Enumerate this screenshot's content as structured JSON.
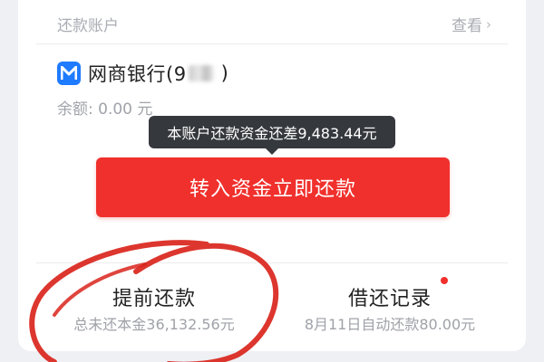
{
  "account_section": {
    "title": "还款账户",
    "view_label": "查看",
    "view_icon": "chevron-right-icon"
  },
  "bank": {
    "logo_icon": "mybank-logo-icon",
    "name": "网商银行(9",
    "masked_suffix": ")",
    "balance": "余额: 0.00 元"
  },
  "tooltip": {
    "text": "本账户还款资金还差9,483.44元"
  },
  "primary_action": {
    "label": "转入资金立即还款"
  },
  "bottom_actions": [
    {
      "title": "提前还款",
      "subtitle": "总未还本金36,132.56元"
    },
    {
      "title": "借还记录",
      "subtitle": "8月11日自动还款80.00元",
      "has_badge_dot": true
    }
  ],
  "colors": {
    "accent_red": "#f0302c",
    "bank_blue": "#1f7bff",
    "annotation_red": "#d9251c",
    "tooltip_bg": "#35383d"
  }
}
